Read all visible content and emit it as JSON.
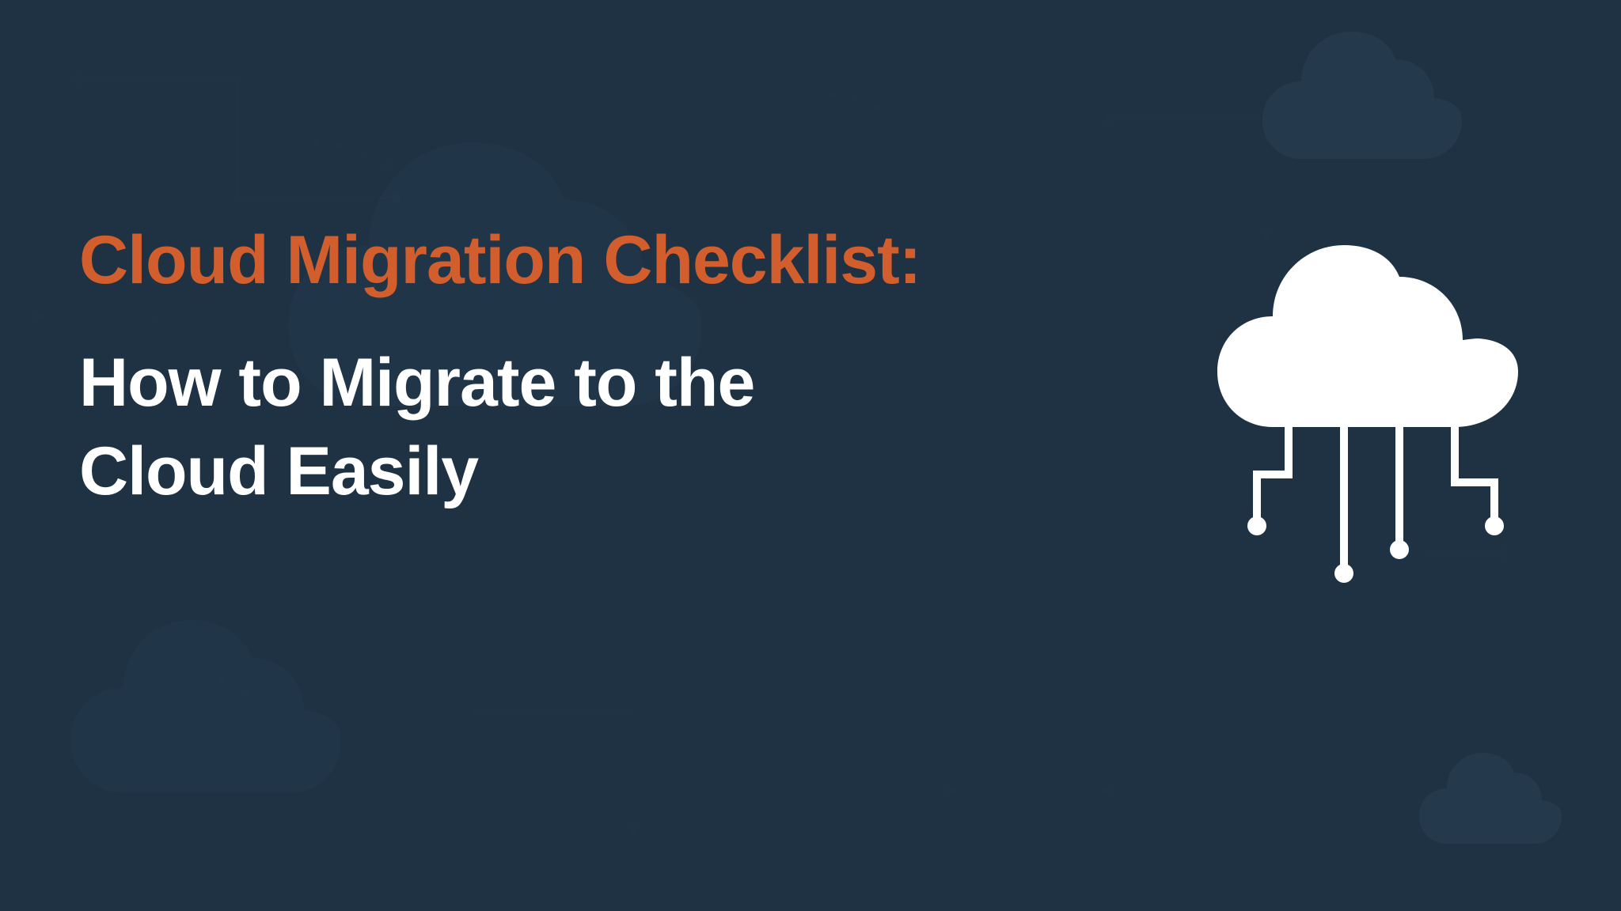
{
  "headline": "Cloud Migration Checklist:",
  "subheadline_line1": "How to Migrate to the",
  "subheadline_line2": "Cloud Easily",
  "colors": {
    "background": "#1e3244",
    "accent": "#d15e2c",
    "text": "#ffffff"
  }
}
